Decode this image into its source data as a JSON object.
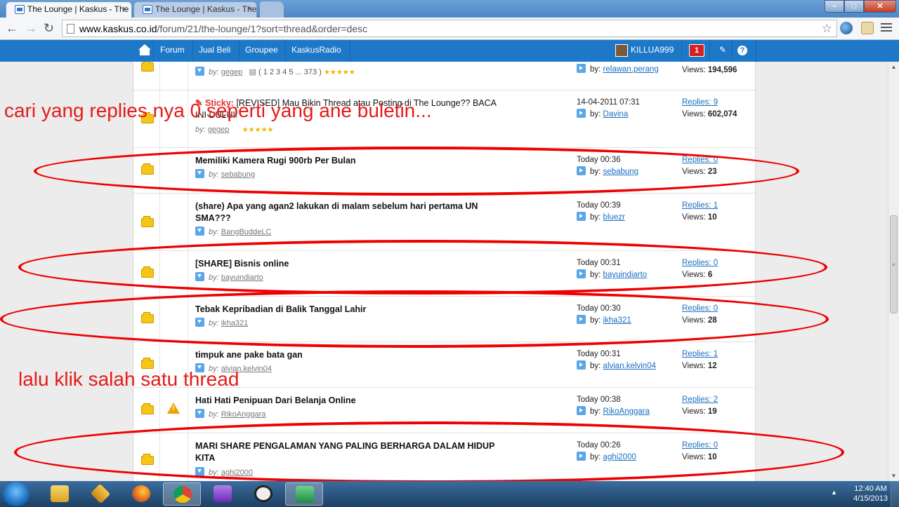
{
  "browser": {
    "tabs": [
      {
        "label": "The Lounge | Kaskus - The",
        "active": true
      },
      {
        "label": "The Lounge | Kaskus - The",
        "active": false
      }
    ],
    "close_glyph": "×",
    "url_host": "www.kaskus.co.id",
    "url_path": "/forum/21/the-lounge/1?sort=thread&order=desc"
  },
  "kaskus_nav": {
    "items": [
      "Forum",
      "Jual Beli",
      "Groupee",
      "KaskusRadio"
    ],
    "username": "KILLUA999",
    "notification_count": "1",
    "help_label": "?"
  },
  "threads": [
    {
      "title": "",
      "sticky": "",
      "by_label": "by:",
      "author": "gegep",
      "pages": "( 1 2 3 4 5 ... 373 )",
      "stars": "★★★★★",
      "last_time": "",
      "last_by": "by:",
      "last_user": "relawan.perang",
      "replies": "",
      "views_label": "Views:",
      "views": "194,596"
    },
    {
      "title": "[REVISED] Mau Bikin Thread atau Posting di The Lounge?? BACA INI DULU!!",
      "sticky": "Sticky:",
      "by_label": "by:",
      "author": "gegep",
      "stars": "★★★★★",
      "last_time": "14-04-2011 07:31",
      "last_by": "by:",
      "last_user": "Davina",
      "replies": "Replies: 9",
      "views_label": "Views:",
      "views": "602,074"
    },
    {
      "title": "Memiliki Kamera Rugi 900rb Per Bulan",
      "by_label": "by:",
      "author": "sebabung",
      "last_time": "Today 00:36",
      "last_by": "by:",
      "last_user": "sebabung",
      "replies": "Replies: 0",
      "views_label": "Views:",
      "views": "23"
    },
    {
      "title": "(share) Apa yang agan2 lakukan di malam sebelum hari pertama UN SMA???",
      "by_label": "by:",
      "author": "BangBuddeLC",
      "last_time": "Today 00:39",
      "last_by": "by:",
      "last_user": "bluezr",
      "replies": "Replies: 1",
      "views_label": "Views:",
      "views": "10"
    },
    {
      "title": "[SHARE] Bisnis online",
      "by_label": "by:",
      "author": "bayuindiarto",
      "last_time": "Today 00:31",
      "last_by": "by:",
      "last_user": "bayuindiarto",
      "replies": "Replies: 0",
      "views_label": "Views:",
      "views": "6"
    },
    {
      "title": "Tebak Kepribadian di Balik Tanggal Lahir",
      "by_label": "by:",
      "author": "ikha321",
      "last_time": "Today 00:30",
      "last_by": "by:",
      "last_user": "ikha321",
      "replies": "Replies: 0",
      "views_label": "Views:",
      "views": "28"
    },
    {
      "title": "timpuk ane pake bata gan",
      "by_label": "by:",
      "author": "alvian.kelvin04",
      "last_time": "Today 00:31",
      "last_by": "by:",
      "last_user": "alvian.kelvin04",
      "replies": "Replies: 1",
      "views_label": "Views:",
      "views": "12"
    },
    {
      "title": "Hati Hati Penipuan Dari Belanja Online",
      "by_label": "by:",
      "author": "RikoAnggara",
      "last_time": "Today 00:38",
      "last_by": "by:",
      "last_user": "RikoAnggara",
      "replies": "Replies: 2",
      "views_label": "Views:",
      "views": "19"
    },
    {
      "title": "MARI SHARE PENGALAMAN YANG PALING BERHARGA DALAM HIDUP KITA",
      "by_label": "by:",
      "author": "aghi2000",
      "last_time": "Today 00:26",
      "last_by": "by:",
      "last_user": "aghi2000",
      "replies": "Replies: 0",
      "views_label": "Views:",
      "views": "10"
    }
  ],
  "annotations": {
    "instruction_1": "cari yang replies nya 0 seperti yang ane buletin...",
    "instruction_2": "lalu klik salah satu thread"
  },
  "taskbar": {
    "time": "12:40 AM",
    "date": "4/15/2013"
  },
  "colors": {
    "kaskus_blue": "#1e78c8",
    "annotation_red": "#e41b1b",
    "link_blue": "#1a6fc2"
  }
}
